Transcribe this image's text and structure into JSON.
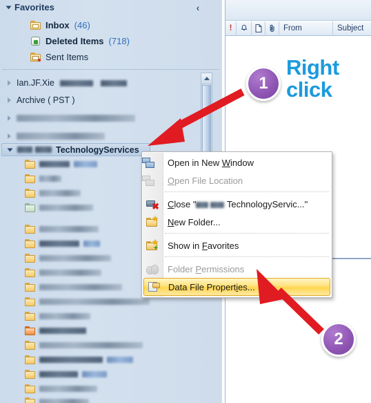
{
  "app": {
    "name": "outlook-navigation-pane",
    "accent_blue": "#1b9bdd",
    "badge_purple": "#9157b5",
    "arrow_red": "#e11b22",
    "highlight_gold": "#ffd64d"
  },
  "nav_pane": {
    "favorites": {
      "label": "Favorites",
      "expanded": true,
      "items": [
        {
          "label": "Inbox",
          "count": "(46)",
          "icon": "inbox-folder-icon"
        },
        {
          "label": "Deleted Items",
          "count": "(718)",
          "icon": "trash-can-icon"
        },
        {
          "label": "Sent Items",
          "count": "",
          "icon": "sent-folder-icon"
        }
      ]
    },
    "collapse_chevron": "‹",
    "accounts": [
      {
        "label": "Ian.JF.Xie",
        "redacted_suffix": true,
        "expanded": false,
        "selected": false
      },
      {
        "label": "Archive ( PST )",
        "redacted_suffix": false,
        "expanded": false,
        "selected": false
      },
      {
        "label": "CCB Asia ISO Suspicious Email Collection Box",
        "redacted": true,
        "expanded": false,
        "selected": false
      },
      {
        "label": "CCB Asia ISO Win Infra Support",
        "redacted": true,
        "expanded": false,
        "selected": false
      },
      {
        "label": "TechnologyServices",
        "redacted_prefix": true,
        "expanded": true,
        "selected": true
      }
    ],
    "subfolder_count": 18,
    "scrollbar": {
      "visible": true,
      "orientation": "vertical"
    }
  },
  "mail_pane": {
    "columns": [
      {
        "label": "!",
        "name": "importance-column"
      },
      {
        "label": "☢",
        "name": "reminder-column"
      },
      {
        "label": "⬜",
        "name": "icon-column"
      },
      {
        "label": "✉",
        "name": "attachment-column"
      },
      {
        "label": "From",
        "name": "from-column"
      },
      {
        "label": "Subject",
        "name": "subject-column"
      }
    ]
  },
  "context_menu": {
    "items": [
      {
        "label": "Open in New Window",
        "underline": "W",
        "enabled": true,
        "icon": "new-window-icon",
        "highlighted": false
      },
      {
        "label": "Open File Location",
        "underline": "O",
        "enabled": false,
        "icon": "open-location-icon",
        "highlighted": false
      },
      {
        "separator_after": true
      },
      {
        "label": "Close \"CCB Asia TechnologyServic...\"",
        "underline": "C",
        "enabled": true,
        "icon": "close-data-file-icon",
        "highlighted": false
      },
      {
        "label": "New Folder...",
        "underline": "N",
        "enabled": true,
        "icon": "new-folder-icon",
        "highlighted": false
      },
      {
        "separator_after": true
      },
      {
        "label": "Show in Favorites",
        "underline": "F",
        "enabled": true,
        "icon": "show-in-favorites-icon",
        "highlighted": false
      },
      {
        "separator_after": true
      },
      {
        "label": "Folder Permissions",
        "underline": "P",
        "enabled": false,
        "icon": "folder-permissions-icon",
        "highlighted": false
      },
      {
        "label": "Data File Properties...",
        "underline": "i",
        "enabled": true,
        "icon": "data-file-properties-icon",
        "highlighted": true
      }
    ]
  },
  "annotations": {
    "step_1": {
      "badge": "1",
      "text_line_1": "Right",
      "text_line_2": "click",
      "points_to": "TechnologyServices account node"
    },
    "step_2": {
      "badge": "2",
      "points_to": "Data File Properties... menu item"
    }
  }
}
